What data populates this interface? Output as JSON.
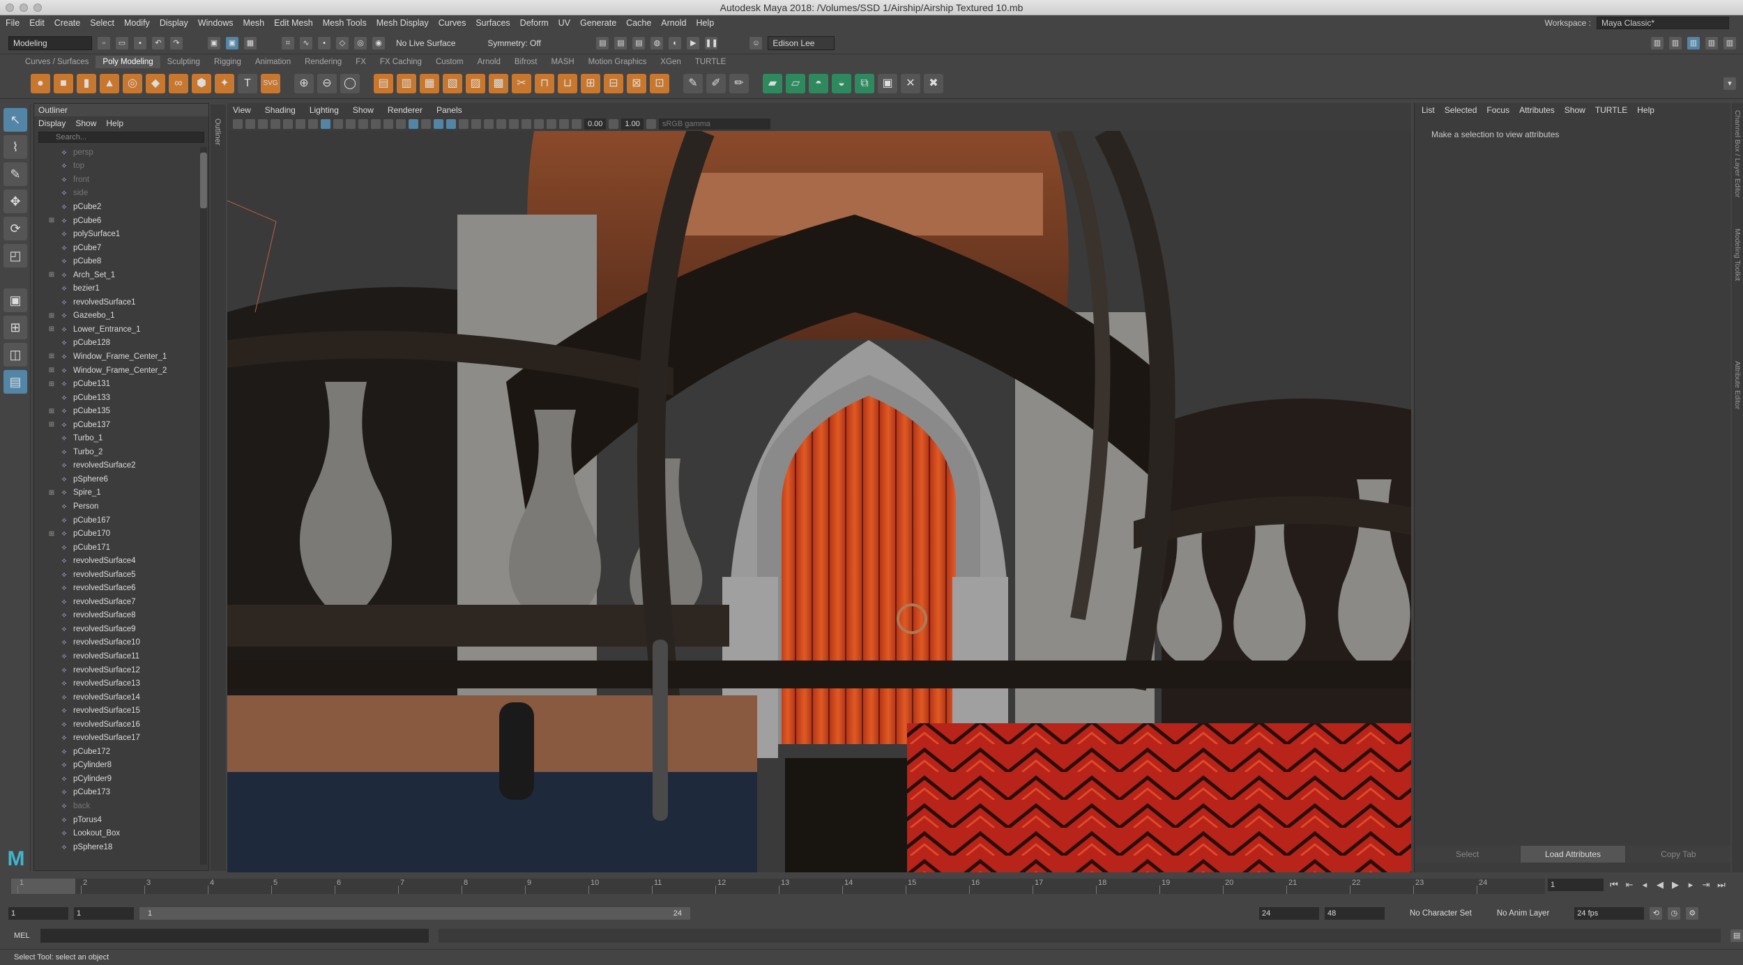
{
  "window": {
    "title": "Autodesk Maya 2018: /Volumes/SSD 1/Airship/Airship Textured 10.mb"
  },
  "menubar": [
    "File",
    "Edit",
    "Create",
    "Select",
    "Modify",
    "Display",
    "Windows",
    "Mesh",
    "Edit Mesh",
    "Mesh Tools",
    "Mesh Display",
    "Curves",
    "Surfaces",
    "Deform",
    "UV",
    "Generate",
    "Cache",
    "Arnold",
    "Help"
  ],
  "workspace": {
    "label": "Workspace :",
    "value": "Maya Classic*"
  },
  "statusline": {
    "mode": "Modeling",
    "live_surface": "No Live Surface",
    "symmetry": "Symmetry: Off",
    "user": "Edison Lee"
  },
  "shelf_tabs": [
    "Curves / Surfaces",
    "Poly Modeling",
    "Sculpting",
    "Rigging",
    "Animation",
    "Rendering",
    "FX",
    "FX Caching",
    "Custom",
    "Arnold",
    "Bifrost",
    "MASH",
    "Motion Graphics",
    "XGen",
    "TURTLE"
  ],
  "shelf_active": "Poly Modeling",
  "outliner": {
    "title": "Outliner",
    "menu": [
      "Display",
      "Show",
      "Help"
    ],
    "search_placeholder": "Search...",
    "items": [
      {
        "name": "persp",
        "dim": true,
        "exp": false
      },
      {
        "name": "top",
        "dim": true,
        "exp": false
      },
      {
        "name": "front",
        "dim": true,
        "exp": false
      },
      {
        "name": "side",
        "dim": true,
        "exp": false
      },
      {
        "name": "pCube2",
        "dim": false,
        "exp": false
      },
      {
        "name": "pCube6",
        "dim": false,
        "exp": true
      },
      {
        "name": "polySurface1",
        "dim": false,
        "exp": false
      },
      {
        "name": "pCube7",
        "dim": false,
        "exp": false
      },
      {
        "name": "pCube8",
        "dim": false,
        "exp": false
      },
      {
        "name": "Arch_Set_1",
        "dim": false,
        "exp": true
      },
      {
        "name": "bezier1",
        "dim": false,
        "exp": false
      },
      {
        "name": "revolvedSurface1",
        "dim": false,
        "exp": false
      },
      {
        "name": "Gazeebo_1",
        "dim": false,
        "exp": true
      },
      {
        "name": "Lower_Entrance_1",
        "dim": false,
        "exp": true
      },
      {
        "name": "pCube128",
        "dim": false,
        "exp": false
      },
      {
        "name": "Window_Frame_Center_1",
        "dim": false,
        "exp": true
      },
      {
        "name": "Window_Frame_Center_2",
        "dim": false,
        "exp": true
      },
      {
        "name": "pCube131",
        "dim": false,
        "exp": true
      },
      {
        "name": "pCube133",
        "dim": false,
        "exp": false
      },
      {
        "name": "pCube135",
        "dim": false,
        "exp": true
      },
      {
        "name": "pCube137",
        "dim": false,
        "exp": true
      },
      {
        "name": "Turbo_1",
        "dim": false,
        "exp": false
      },
      {
        "name": "Turbo_2",
        "dim": false,
        "exp": false
      },
      {
        "name": "revolvedSurface2",
        "dim": false,
        "exp": false
      },
      {
        "name": "pSphere6",
        "dim": false,
        "exp": false
      },
      {
        "name": "Spire_1",
        "dim": false,
        "exp": true
      },
      {
        "name": "Person",
        "dim": false,
        "exp": false
      },
      {
        "name": "pCube167",
        "dim": false,
        "exp": false
      },
      {
        "name": "pCube170",
        "dim": false,
        "exp": true
      },
      {
        "name": "pCube171",
        "dim": false,
        "exp": false
      },
      {
        "name": "revolvedSurface4",
        "dim": false,
        "exp": false
      },
      {
        "name": "revolvedSurface5",
        "dim": false,
        "exp": false
      },
      {
        "name": "revolvedSurface6",
        "dim": false,
        "exp": false
      },
      {
        "name": "revolvedSurface7",
        "dim": false,
        "exp": false
      },
      {
        "name": "revolvedSurface8",
        "dim": false,
        "exp": false
      },
      {
        "name": "revolvedSurface9",
        "dim": false,
        "exp": false
      },
      {
        "name": "revolvedSurface10",
        "dim": false,
        "exp": false
      },
      {
        "name": "revolvedSurface11",
        "dim": false,
        "exp": false
      },
      {
        "name": "revolvedSurface12",
        "dim": false,
        "exp": false
      },
      {
        "name": "revolvedSurface13",
        "dim": false,
        "exp": false
      },
      {
        "name": "revolvedSurface14",
        "dim": false,
        "exp": false
      },
      {
        "name": "revolvedSurface15",
        "dim": false,
        "exp": false
      },
      {
        "name": "revolvedSurface16",
        "dim": false,
        "exp": false
      },
      {
        "name": "revolvedSurface17",
        "dim": false,
        "exp": false
      },
      {
        "name": "pCube172",
        "dim": false,
        "exp": false
      },
      {
        "name": "pCylinder8",
        "dim": false,
        "exp": false
      },
      {
        "name": "pCylinder9",
        "dim": false,
        "exp": false
      },
      {
        "name": "pCube173",
        "dim": false,
        "exp": false
      },
      {
        "name": "back",
        "dim": true,
        "exp": false
      },
      {
        "name": "pTorus4",
        "dim": false,
        "exp": false
      },
      {
        "name": "Lookout_Box",
        "dim": false,
        "exp": false
      },
      {
        "name": "pSphere18",
        "dim": false,
        "exp": false
      }
    ]
  },
  "side_label": "Outliner",
  "panel": {
    "menu": [
      "View",
      "Shading",
      "Lighting",
      "Show",
      "Renderer",
      "Panels"
    ],
    "exposure": "0.00",
    "gamma": "1.00",
    "colorspace": "sRGB gamma"
  },
  "attr": {
    "menu": [
      "List",
      "Selected",
      "Focus",
      "Attributes",
      "Show",
      "TURTLE",
      "Help"
    ],
    "message": "Make a selection to view attributes",
    "buttons": [
      "Select",
      "Load Attributes",
      "Copy Tab"
    ]
  },
  "right_tabs": [
    "Channel Box / Layer Editor",
    "Modeling Toolkit",
    "Attribute Editor"
  ],
  "timeline": {
    "ticks": [
      "1",
      "2",
      "3",
      "4",
      "5",
      "6",
      "7",
      "8",
      "9",
      "10",
      "11",
      "12",
      "13",
      "14",
      "15",
      "16",
      "17",
      "18",
      "19",
      "20",
      "21",
      "22",
      "23",
      "24"
    ],
    "current": "1"
  },
  "range": {
    "start": "1",
    "anim_start": "1",
    "slider_start": "1",
    "slider_end": "24",
    "end": "24",
    "anim_end": "48",
    "character_set": "No Character Set",
    "anim_layer": "No Anim Layer",
    "fps": "24 fps"
  },
  "cmdline": {
    "label": "MEL"
  },
  "helpline": "Select Tool: select an object",
  "colors": {
    "accent": "#5285a6",
    "panel_bg": "#444444",
    "door": "#d04a1c",
    "rug": "#b8231a"
  }
}
